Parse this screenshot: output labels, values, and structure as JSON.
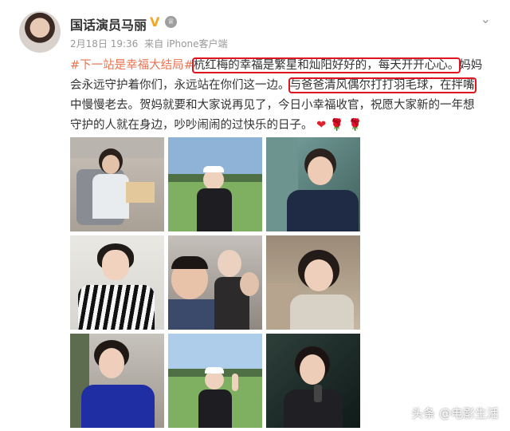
{
  "user": {
    "name": "国话演员马丽",
    "verified_icon": "verified-v-icon",
    "badge_icon": "member-badge-icon"
  },
  "meta": {
    "date": "2月18日 19:36",
    "source": "来自 iPhone客户端"
  },
  "post": {
    "hashtag": "#下一站是幸福大结局#",
    "line1_highlight": "杭红梅的幸福是繁星和灿阳好好的，每天开开心心。",
    "line1_tail": "妈妈",
    "line2_head": "会永远守护着你们，永远站在你们这一边。",
    "line2_highlight": "与爸爸清风偶尔打打羽毛球，在拌嘴",
    "line3": "中慢慢老去。贺妈就要和大家说再见了，今日小幸福收官，祝愿大家新的一年想",
    "line4": "守护的人就在身边，吵吵闹闹的过快乐的日子。",
    "emoji": [
      "heart-emoji",
      "rose-emoji",
      "rose-emoji"
    ]
  },
  "photos": [
    "photo-1",
    "photo-2",
    "photo-3",
    "photo-4",
    "photo-5",
    "photo-6",
    "photo-7",
    "photo-8",
    "photo-9"
  ],
  "watermark": "头条 @电影生活",
  "colors": {
    "hashtag": "#eb7350",
    "highlight_box": "#e0141e",
    "verified": "#f5a623"
  }
}
